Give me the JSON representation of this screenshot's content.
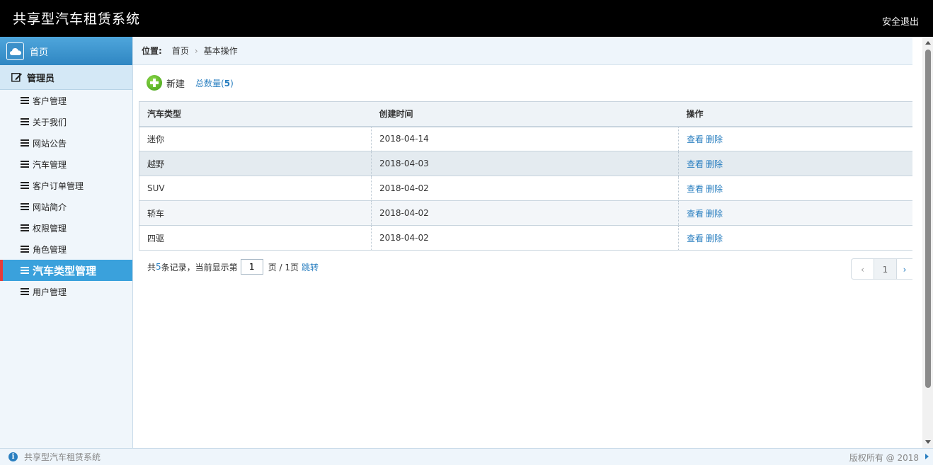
{
  "header": {
    "title": "共享型汽车租赁系统",
    "logout": "安全退出"
  },
  "sidebar": {
    "home": "首页",
    "group": "管理员",
    "items": [
      {
        "label": "客户管理"
      },
      {
        "label": "关于我们"
      },
      {
        "label": "网站公告"
      },
      {
        "label": "汽车管理"
      },
      {
        "label": "客户订单管理"
      },
      {
        "label": "网站简介"
      },
      {
        "label": "权限管理"
      },
      {
        "label": "角色管理"
      },
      {
        "label": "汽车类型管理"
      },
      {
        "label": "用户管理"
      }
    ],
    "active_index": 8
  },
  "breadcrumb": {
    "label": "位置:",
    "home": "首页",
    "current": "基本操作"
  },
  "toolbar": {
    "add_label": "新建",
    "total_prefix": "总数量(",
    "total_count": "5",
    "total_suffix": ")"
  },
  "table": {
    "headers": [
      "汽车类型",
      "创建时间",
      "操作"
    ],
    "rows": [
      {
        "type": "迷你",
        "date": "2018-04-14"
      },
      {
        "type": "越野",
        "date": "2018-04-03"
      },
      {
        "type": "SUV",
        "date": "2018-04-02"
      },
      {
        "type": "轿车",
        "date": "2018-04-02"
      },
      {
        "type": "四驱",
        "date": "2018-04-02"
      }
    ],
    "view_label": "查看",
    "delete_label": "删除"
  },
  "pager": {
    "prefix": "共",
    "records": "5",
    "records_suffix": "条记录，",
    "current_prefix": "当前显示第",
    "page_value": "1",
    "page_suffix": "页 / 1页",
    "jump": "跳转",
    "prev": "‹",
    "current_page": "1",
    "next": "›"
  },
  "footer": {
    "app_name": "共享型汽车租赁系统",
    "copyright": "版权所有 @ 2018"
  }
}
